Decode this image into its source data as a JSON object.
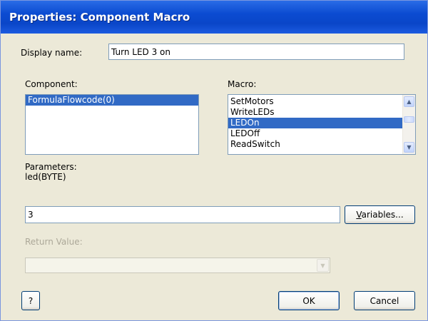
{
  "window": {
    "title": "Properties: Component Macro"
  },
  "display_name": {
    "label": "Display name:",
    "value": "Turn LED 3 on"
  },
  "component": {
    "label": "Component:",
    "items": [
      {
        "label": "FormulaFlowcode(0)",
        "selected": true
      }
    ]
  },
  "macro": {
    "label": "Macro:",
    "items": [
      {
        "label": "SetMotors",
        "selected": false
      },
      {
        "label": "WriteLEDs",
        "selected": false
      },
      {
        "label": "LEDOn",
        "selected": true
      },
      {
        "label": "LEDOff",
        "selected": false
      },
      {
        "label": "ReadSwitch",
        "selected": false
      }
    ]
  },
  "parameters": {
    "label": "Parameters:",
    "signature": "led(BYTE)",
    "value": "3",
    "variables_button": "Variables..."
  },
  "return_value": {
    "label": "Return Value:",
    "value": ""
  },
  "buttons": {
    "help": "?",
    "ok": "OK",
    "cancel": "Cancel"
  },
  "colors": {
    "selection": "#316ac5",
    "titlebar": "#0b4bd1",
    "dialog_bg": "#ece9d8"
  }
}
